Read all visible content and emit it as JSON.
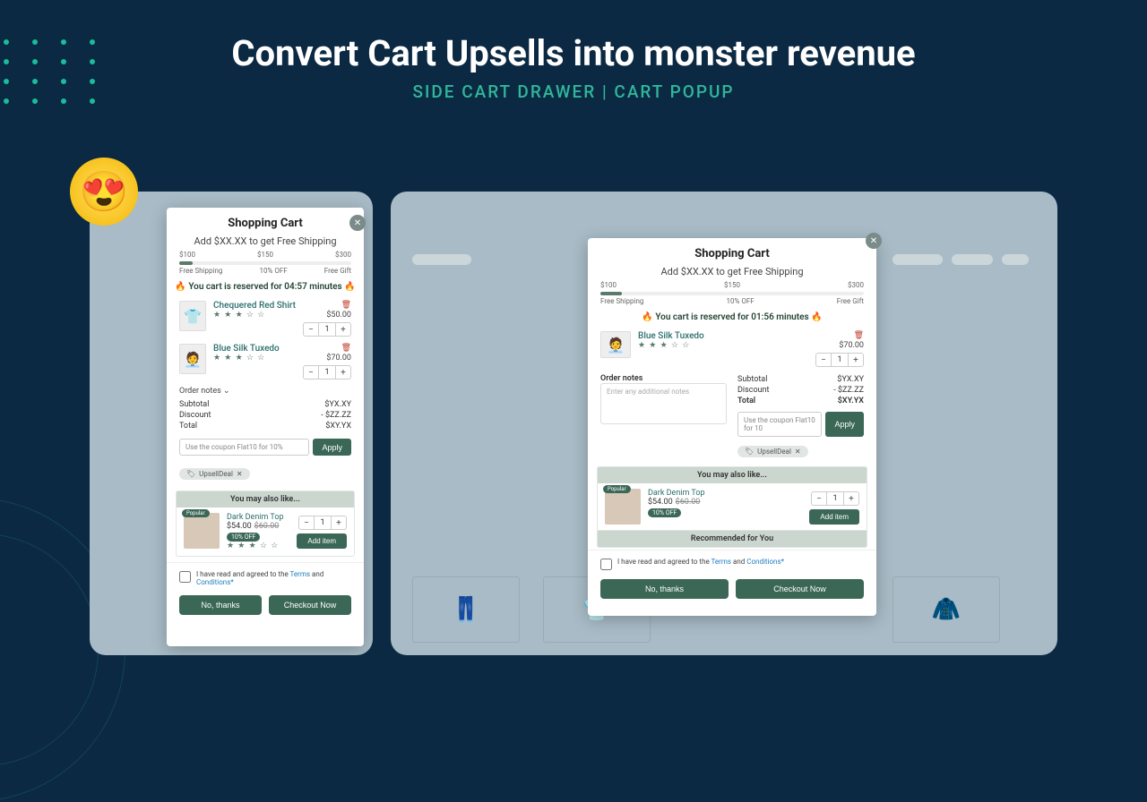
{
  "headline": "Convert Cart Upsells into monster revenue",
  "subtitle": "SIDE CART DRAWER | CART POPUP",
  "cartA": {
    "title": "Shopping Cart",
    "ship_goal": "Add $XX.XX to get Free Shipping",
    "ticks": [
      "$100",
      "$150",
      "$300"
    ],
    "labels": [
      "Free Shipping",
      "10% OFF",
      "Free Gift"
    ],
    "timer": "🔥 You cart is reserved for 04:57 minutes 🔥",
    "items": [
      {
        "name": "Chequered Red Shirt",
        "price": "$50.00",
        "qty": "1",
        "stars": "★ ★ ★ ☆ ☆"
      },
      {
        "name": "Blue Silk Tuxedo",
        "price": "$70.00",
        "qty": "1",
        "stars": "★ ★ ★ ☆ ☆"
      }
    ],
    "notes_label": "Order notes",
    "totals": [
      {
        "label": "Subtotal",
        "value": "$YX.XY"
      },
      {
        "label": "Discount",
        "value": "- $ZZ.ZZ"
      },
      {
        "label": "Total",
        "value": "$XY.YX"
      }
    ],
    "coupon_placeholder": "Use the coupon Flat10 for 10%",
    "apply": "Apply",
    "chip": "UpsellDeal",
    "upsell": {
      "heading": "You may also like...",
      "name": "Dark Denim Top",
      "price": "$54.00",
      "compare": "$60.00",
      "off": "10% OFF",
      "popular": "Popular",
      "add": "Add item",
      "qty": "1",
      "stars": "★ ★ ★ ☆ ☆"
    },
    "agree_prefix": "I have read and agreed to the ",
    "agree_terms": "Terms",
    "agree_and": " and ",
    "agree_cond": "Conditions*",
    "no": "No, thanks",
    "checkout": "Checkout Now"
  },
  "cartB": {
    "title": "Shopping Cart",
    "ship_goal": "Add $XX.XX to get Free Shipping",
    "ticks": [
      "$100",
      "$150",
      "$300"
    ],
    "labels": [
      "Free Shipping",
      "10% OFF",
      "Free Gift"
    ],
    "timer": "🔥 You cart is reserved for 01:56 minutes 🔥",
    "item": {
      "name": "Blue Silk Tuxedo",
      "price": "$70.00",
      "qty": "1",
      "stars": "★ ★ ★ ☆ ☆"
    },
    "notes_label": "Order notes",
    "notes_placeholder": "Enter any additional notes",
    "totals": [
      {
        "label": "Subtotal",
        "value": "$YX.XY"
      },
      {
        "label": "Discount",
        "value": "- $ZZ.ZZ"
      },
      {
        "label": "Total",
        "value": "$XY.YX"
      }
    ],
    "coupon_placeholder": "Use the coupon Flat10 for 10",
    "apply": "Apply",
    "chip": "UpsellDeal",
    "upsell": {
      "heading": "You may also like...",
      "name": "Dark Denim Top",
      "price": "$54.00",
      "compare": "$60.00",
      "off": "10% OFF",
      "popular": "Popular",
      "add": "Add item",
      "qty": "1"
    },
    "rec_heading": "Recommended for You",
    "agree_prefix": "I have read and agreed to the ",
    "agree_terms": "Terms",
    "agree_and": " and ",
    "agree_cond": "Conditions*",
    "no": "No, thanks",
    "checkout": "Checkout Now"
  }
}
